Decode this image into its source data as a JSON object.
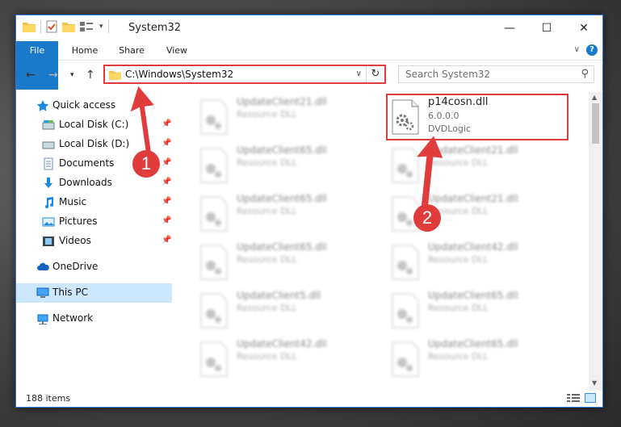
{
  "window": {
    "title": "System32",
    "controls": {
      "minimize": "—",
      "maximize": "☐",
      "close": "✕"
    }
  },
  "ribbon": {
    "tabs": [
      "File",
      "Home",
      "Share",
      "View"
    ],
    "help": "?"
  },
  "address": {
    "path": "C:\\Windows\\System32"
  },
  "search": {
    "placeholder": "Search System32"
  },
  "sidebar": {
    "items": [
      {
        "label": "Quick access",
        "icon": "star-icon",
        "pinned": false
      },
      {
        "label": "Local Disk (C:)",
        "icon": "drive-icon",
        "pinned": true
      },
      {
        "label": "Local Disk (D:)",
        "icon": "drive-icon",
        "pinned": true
      },
      {
        "label": "Documents",
        "icon": "documents-icon",
        "pinned": true
      },
      {
        "label": "Downloads",
        "icon": "download-icon",
        "pinned": true
      },
      {
        "label": "Music",
        "icon": "music-icon",
        "pinned": true
      },
      {
        "label": "Pictures",
        "icon": "pictures-icon",
        "pinned": true
      },
      {
        "label": "Videos",
        "icon": "videos-icon",
        "pinned": true
      },
      {
        "label": "OneDrive",
        "icon": "cloud-icon",
        "pinned": false
      },
      {
        "label": "This PC",
        "icon": "computer-icon",
        "pinned": false
      },
      {
        "label": "Network",
        "icon": "network-icon",
        "pinned": false
      }
    ]
  },
  "files": {
    "highlighted": {
      "name": "p14cosn.dll",
      "version": "6.0.0.0",
      "company": "DVDLogic"
    },
    "left_column": [
      {
        "name": "UpdateClient21.dll",
        "sub": "Resource DLL"
      },
      {
        "name": "UpdateClient65.dll",
        "sub": "Resource DLL"
      },
      {
        "name": "UpdateClient65.dll",
        "sub": "Resource DLL"
      },
      {
        "name": "UpdateClient65.dll",
        "sub": "Resource DLL"
      },
      {
        "name": "UpdateClient5.dll",
        "sub": "Resource DLL"
      },
      {
        "name": "UpdateClient42.dll",
        "sub": "Resource DLL"
      }
    ],
    "right_column": [
      {
        "name": "UpdateClient21.dll",
        "sub": "Resource DLL"
      },
      {
        "name": "UpdateClient21.dll",
        "sub": "Resource DLL"
      },
      {
        "name": "UpdateClient42.dll",
        "sub": "Resource DLL"
      },
      {
        "name": "UpdateClient65.dll",
        "sub": "Resource DLL"
      },
      {
        "name": "UpdateClient65.dll",
        "sub": "Resource DLL"
      }
    ]
  },
  "status": {
    "item_count": "188 items"
  },
  "annotations": {
    "step1": "1",
    "step2": "2",
    "color": "#e03c3c"
  }
}
